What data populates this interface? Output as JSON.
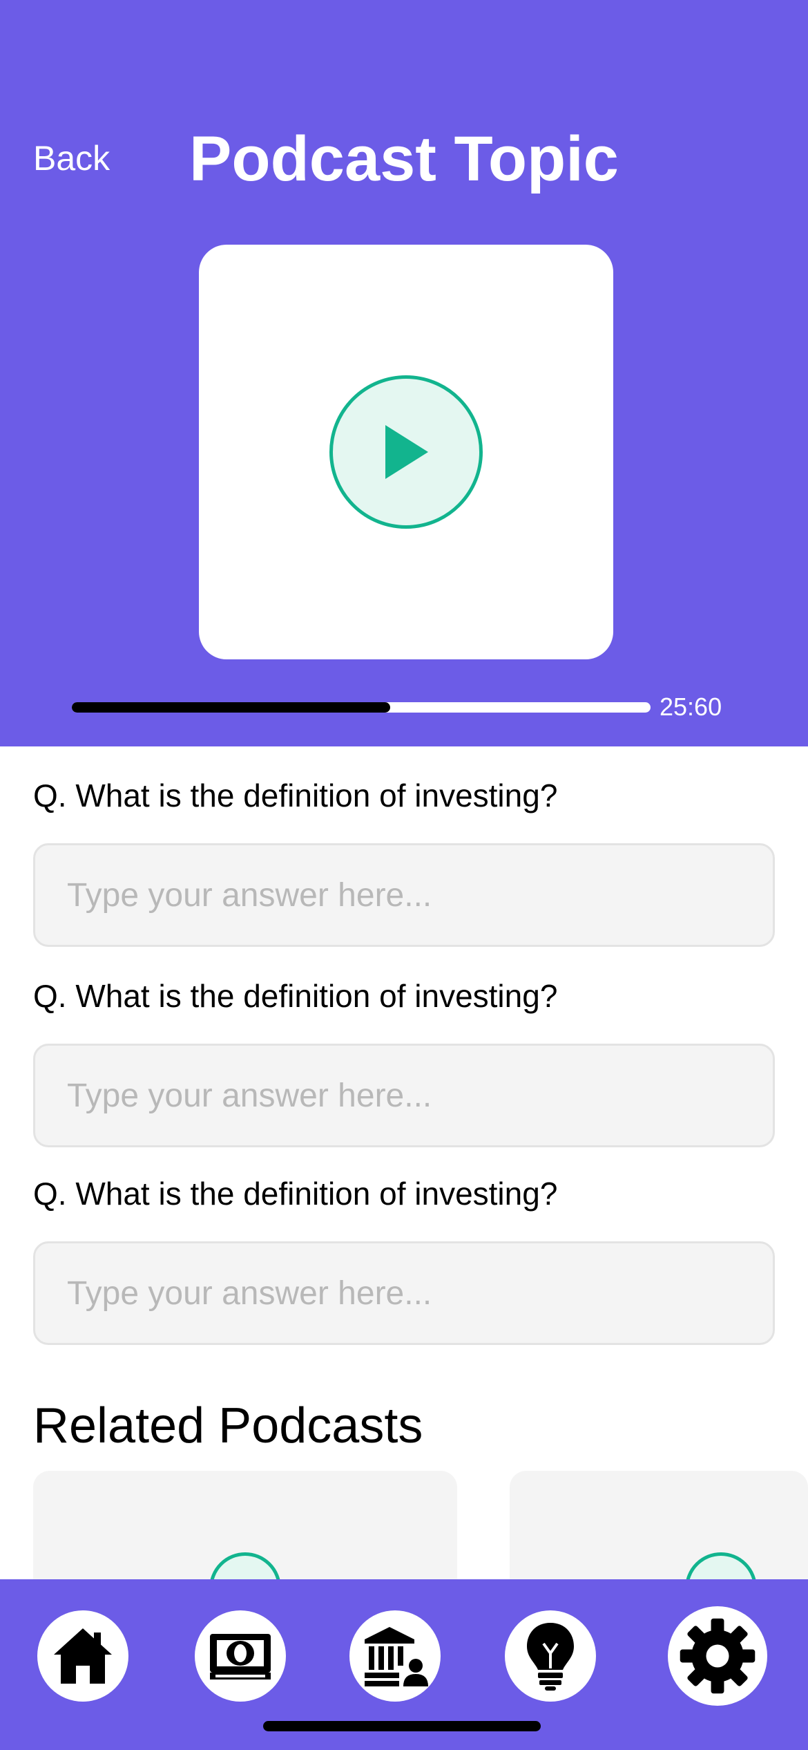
{
  "header": {
    "back_label": "Back",
    "title": "Podcast Topic"
  },
  "player": {
    "progress": 0.55,
    "time": "25:60"
  },
  "questions": [
    {
      "text": "Q. What is the definition of investing?",
      "placeholder": "Type your answer here..."
    },
    {
      "text": "Q. What is the definition of investing?",
      "placeholder": "Type your answer here..."
    },
    {
      "text": "Q. What is the definition of investing?",
      "placeholder": "Type your answer here..."
    }
  ],
  "related": {
    "title": "Related Podcasts"
  },
  "nav": {
    "items": [
      "home-icon",
      "money-icon",
      "bank-icon",
      "lightbulb-icon",
      "gear-icon"
    ]
  },
  "colors": {
    "accent": "#6C5CE7",
    "play_green": "#12B48E",
    "play_bg": "#E4F7F1"
  }
}
